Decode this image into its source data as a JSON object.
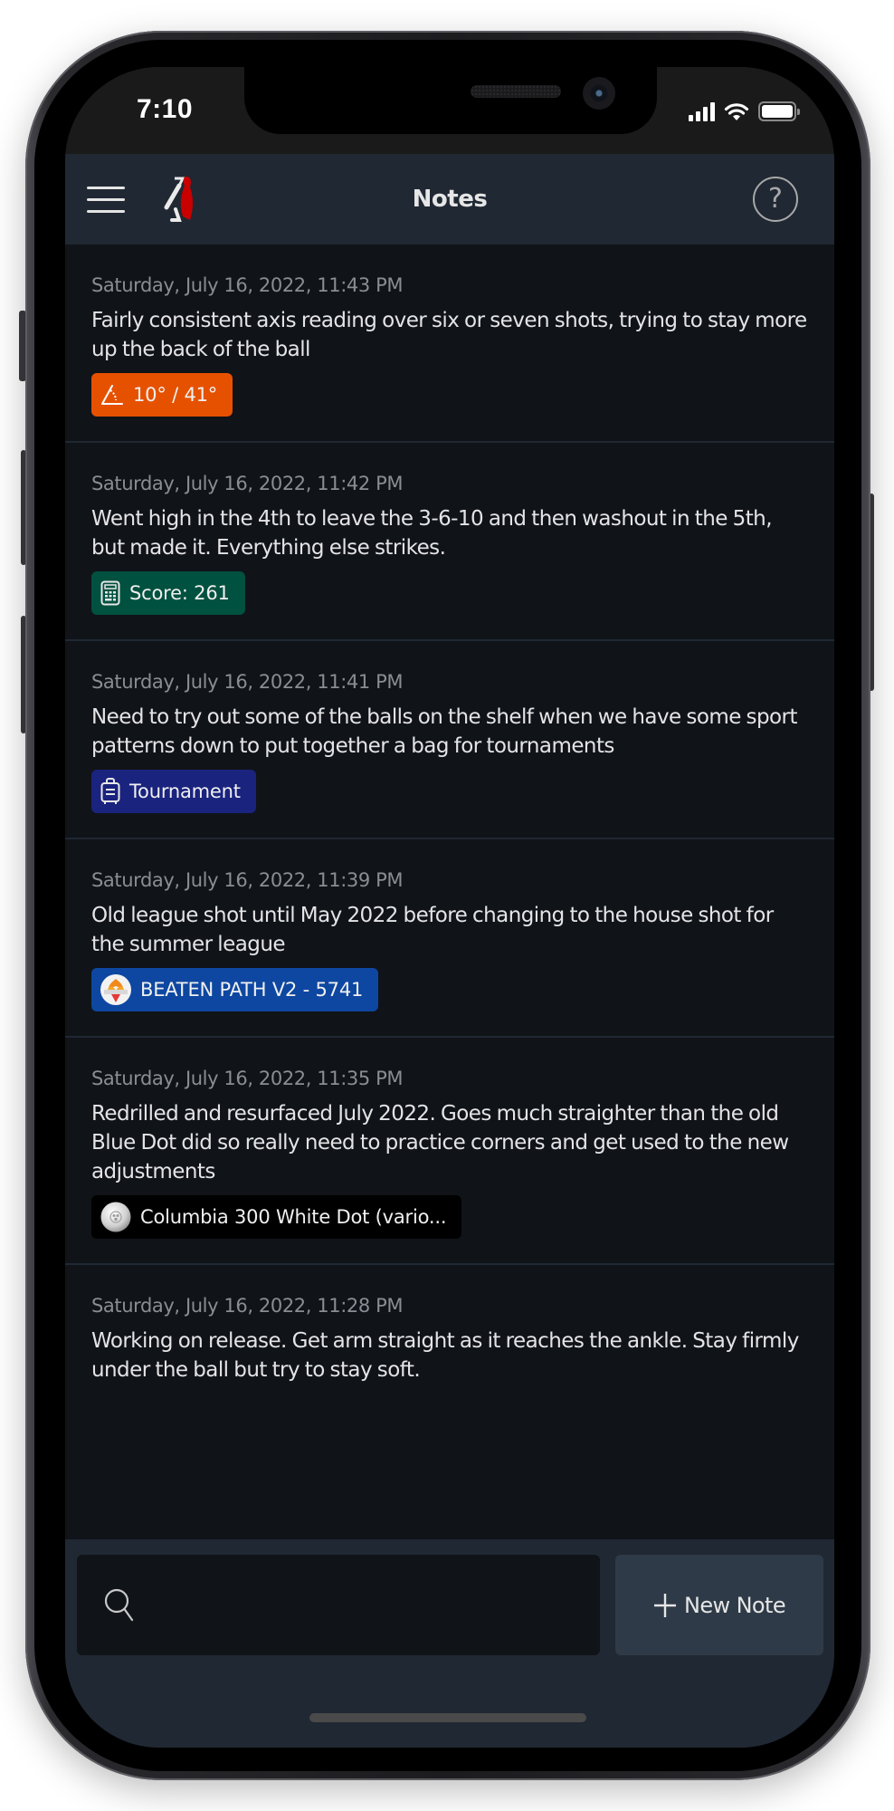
{
  "status_bar": {
    "time": "7:10",
    "signal_bars": 4,
    "battery_level": 1.0
  },
  "header": {
    "title": "Notes",
    "menu_icon": "hamburger-menu-icon",
    "logo_icon": "bowler-pin-logo-icon",
    "help_icon": "question-circle-icon",
    "help_glyph": "?"
  },
  "notes": [
    {
      "date": "Saturday, July 16, 2022, 11:43 PM",
      "text": "Fairly consistent axis reading over six or seven shots, trying to stay more up the back of the ball",
      "tag": {
        "type": "axis",
        "icon": "axis-angle-icon",
        "label": "10° / 41°",
        "color": "#e65100"
      }
    },
    {
      "date": "Saturday, July 16, 2022, 11:42 PM",
      "text": "Went high in the 4th to leave the 3-6-10 and then washout in the 5th, but made it. Everything else strikes.",
      "tag": {
        "type": "score",
        "icon": "calculator-icon",
        "label": "Score: 261",
        "color": "#00513f"
      }
    },
    {
      "date": "Saturday, July 16, 2022, 11:41 PM",
      "text": "Need to try out some of the balls on the shelf when we have some sport patterns down to put together a bag for tournaments",
      "tag": {
        "type": "event",
        "icon": "luggage-icon",
        "label": "Tournament",
        "color": "#1a237e"
      }
    },
    {
      "date": "Saturday, July 16, 2022, 11:39 PM",
      "text": "Old league shot until May 2022 before changing to the house shot for the summer league",
      "tag": {
        "type": "oil-pattern",
        "icon": "kegel-logo-icon",
        "label": "BEATEN PATH V2 - 5741",
        "color": "#0d47a1"
      }
    },
    {
      "date": "Saturday, July 16, 2022, 11:35 PM",
      "text": "Redrilled and resurfaced July 2022. Goes much straighter than the old Blue Dot did so really need to practice corners and get used to the new adjustments",
      "tag": {
        "type": "ball",
        "icon": "bowling-ball-icon",
        "label": "Columbia 300 White Dot (vario...",
        "color": "#000000"
      }
    },
    {
      "date": "Saturday, July 16, 2022, 11:28 PM",
      "text": "Working on release. Get arm straight as it reaches the ankle. Stay firmly under the ball but try to stay soft.",
      "tag": null
    }
  ],
  "bottom_bar": {
    "search_value": "",
    "search_placeholder": "",
    "search_icon": "search-icon",
    "new_note_label": "New Note",
    "new_note_icon": "plus-icon"
  },
  "colors": {
    "screen_bg": "#101318",
    "header_bg": "#202833",
    "status_bg": "#1a1a1a",
    "button_bg": "#2e3a47",
    "date_text": "#8a8d93",
    "body_text": "#e4e4e6"
  }
}
